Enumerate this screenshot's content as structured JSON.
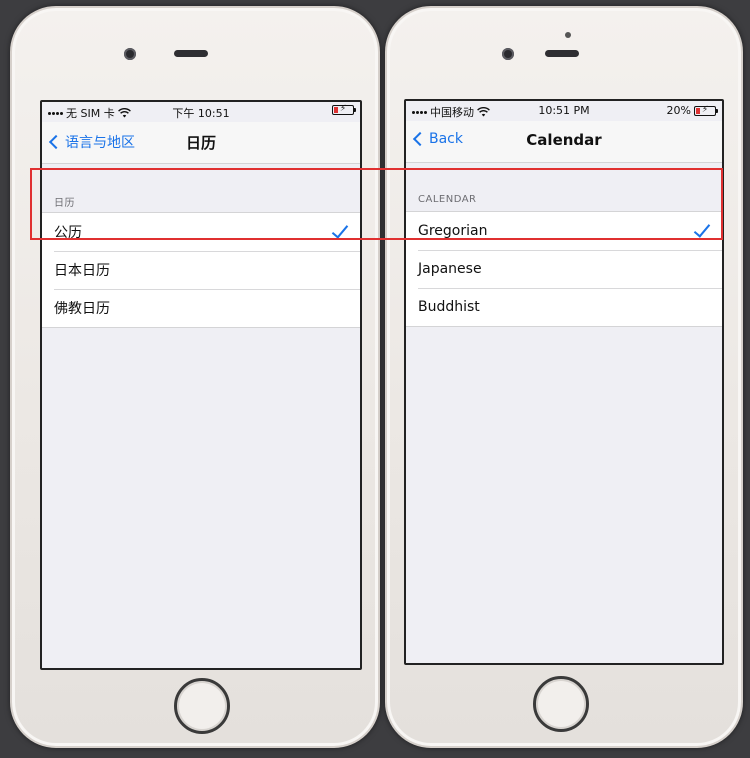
{
  "left_phone": {
    "status": {
      "carrier": "无 SIM 卡",
      "time": "下午 10:51",
      "battery_percent": ""
    },
    "nav": {
      "back_label": "语言与地区",
      "title": "日历"
    },
    "section_header": "日历",
    "rows": [
      {
        "label": "公历",
        "selected": true
      },
      {
        "label": "日本日历",
        "selected": false
      },
      {
        "label": "佛教日历",
        "selected": false
      }
    ]
  },
  "right_phone": {
    "status": {
      "carrier": "中国移动",
      "time": "10:51 PM",
      "battery_percent": "20%"
    },
    "nav": {
      "back_label": "Back",
      "title": "Calendar"
    },
    "section_header": "CALENDAR",
    "rows": [
      {
        "label": "Gregorian",
        "selected": true
      },
      {
        "label": "Japanese",
        "selected": false
      },
      {
        "label": "Buddhist",
        "selected": false
      }
    ]
  },
  "colors": {
    "accent": "#1a73e8",
    "highlight": "#e03030",
    "grouped_background": "#efeff4"
  },
  "icons": [
    "wifi-icon",
    "battery-icon",
    "chevron-left-icon",
    "checkmark-icon",
    "home-button"
  ]
}
